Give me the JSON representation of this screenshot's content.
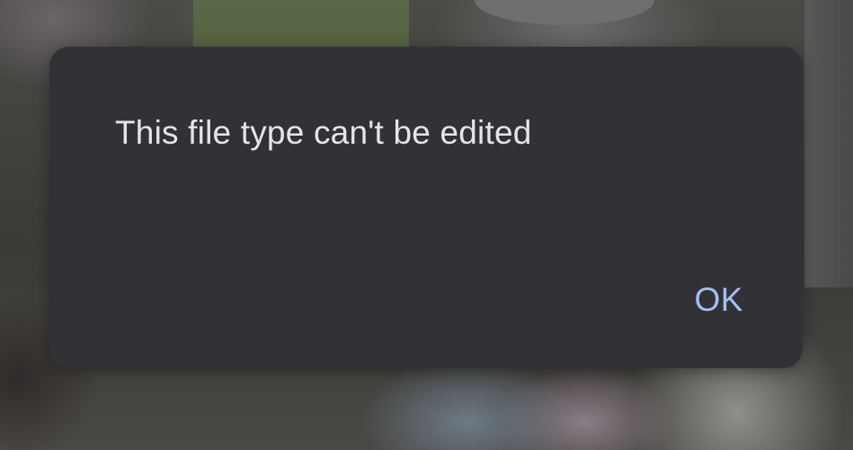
{
  "dialog": {
    "message": "This file type can't be edited",
    "ok_label": "OK"
  },
  "colors": {
    "dialog_background": "#323136",
    "message_text": "#e6e4ea",
    "ok_accent": "#a4bff4"
  }
}
